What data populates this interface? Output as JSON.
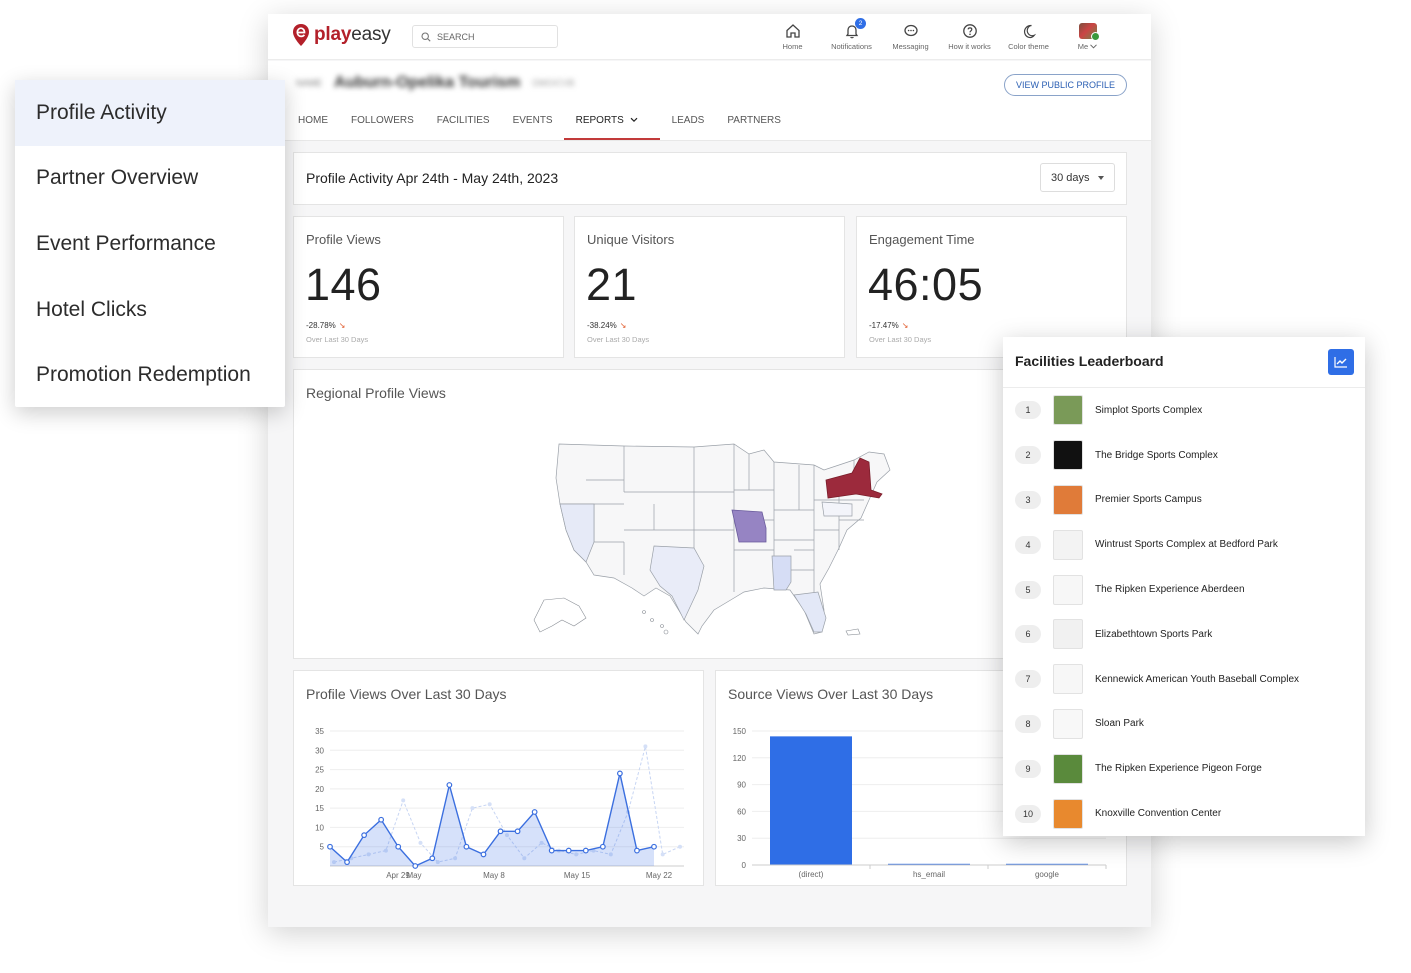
{
  "brand": {
    "name_bold": "play",
    "name_light": "easy",
    "color": "#b3202a"
  },
  "search": {
    "placeholder": "SEARCH"
  },
  "nav": [
    {
      "label": "Home",
      "icon": "home-icon"
    },
    {
      "label": "Notifications",
      "icon": "bell-icon",
      "badge": "2"
    },
    {
      "label": "Messaging",
      "icon": "chat-icon"
    },
    {
      "label": "How it works",
      "icon": "help-icon"
    },
    {
      "label": "Color theme",
      "icon": "moon-icon"
    },
    {
      "label": "Me",
      "icon": "avatar"
    }
  ],
  "profile": {
    "prefix": "NAME",
    "name": "Auburn-Opelika Tourism",
    "tag": "DMO/CVB",
    "view_public": "VIEW PUBLIC PROFILE"
  },
  "tabs": [
    "HOME",
    "FOLLOWERS",
    "FACILITIES",
    "EVENTS",
    "REPORTS",
    "LEADS",
    "PARTNERS"
  ],
  "active_tab": "REPORTS",
  "period": {
    "title": "Profile Activity Apr 24th - May 24th, 2023",
    "select": "30 days"
  },
  "stats": [
    {
      "label": "Profile Views",
      "value": "146",
      "delta": "-28.78%",
      "note": "Over Last 30 Days"
    },
    {
      "label": "Unique Visitors",
      "value": "21",
      "delta": "-38.24%",
      "note": "Over Last 30 Days"
    },
    {
      "label": "Engagement Time",
      "value": "46:05",
      "delta": "-17.47%",
      "note": "Over Last 30 Days"
    }
  ],
  "regional": {
    "title": "Regional Profile Views"
  },
  "menu": [
    "Profile Activity",
    "Partner Overview",
    "Event Performance",
    "Hotel Clicks",
    "Promotion Redemption"
  ],
  "leaderboard": {
    "title": "Facilities Leaderboard",
    "items": [
      {
        "rank": "1",
        "name": "Simplot Sports Complex",
        "thumb": "#7a9a58"
      },
      {
        "rank": "2",
        "name": "The Bridge Sports Complex",
        "thumb": "#111111"
      },
      {
        "rank": "3",
        "name": "Premier Sports Campus",
        "thumb": "#e07b39"
      },
      {
        "rank": "4",
        "name": "Wintrust Sports Complex at Bedford Park",
        "thumb": "#f3f3f3"
      },
      {
        "rank": "5",
        "name": "The Ripken Experience Aberdeen",
        "thumb": "#f7f7f7"
      },
      {
        "rank": "6",
        "name": "Elizabethtown Sports Park",
        "thumb": "#f1f1f1"
      },
      {
        "rank": "7",
        "name": "Kennewick American Youth Baseball Complex",
        "thumb": "#f7f7f7"
      },
      {
        "rank": "8",
        "name": "Sloan Park",
        "thumb": "#f8f8f8"
      },
      {
        "rank": "9",
        "name": "The Ripken Experience Pigeon Forge",
        "thumb": "#5a8a3c"
      },
      {
        "rank": "10",
        "name": "Knoxville Convention Center",
        "thumb": "#e8892e"
      }
    ]
  },
  "chart_data": [
    {
      "type": "area",
      "title": "Profile Views Over Last 30 Days",
      "x_ticks": [
        "Apr 29",
        "May",
        "May 8",
        "May 15",
        "May 22"
      ],
      "ylim": [
        0,
        35
      ],
      "y_ticks": [
        5,
        10,
        15,
        20,
        25,
        30,
        35
      ],
      "series": [
        {
          "values": [
            5,
            1,
            8,
            12,
            5,
            0,
            2,
            21,
            5,
            3,
            9,
            9,
            14,
            4,
            4,
            4,
            5,
            24,
            4,
            5
          ]
        },
        {
          "values": [
            1,
            2,
            3,
            4,
            17,
            6,
            1,
            2,
            15,
            16,
            8,
            2,
            6,
            4,
            3,
            4,
            3,
            14,
            31,
            3,
            5
          ]
        }
      ],
      "grid": true
    },
    {
      "type": "bar",
      "title": "Source Views Over Last 30 Days",
      "categories": [
        "(direct)",
        "hs_email",
        "google"
      ],
      "values": [
        144,
        1,
        1
      ],
      "ylim": [
        0,
        150
      ],
      "y_ticks": [
        0,
        30,
        60,
        90,
        120,
        150
      ],
      "color": "#2f6ee6",
      "grid": true
    }
  ]
}
